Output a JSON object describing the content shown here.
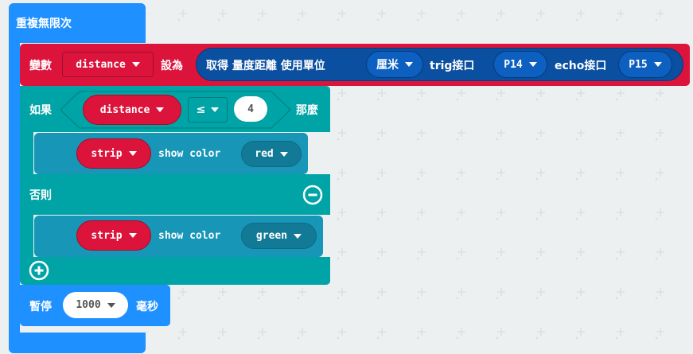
{
  "forever": {
    "label": "重複無限次",
    "color": "#1e90ff"
  },
  "set_var": {
    "label": "變數",
    "var_name": "distance",
    "assign_label": "設為",
    "color": "#dc143c",
    "sonar": {
      "label_get": "取得 量度距離 使用單位",
      "unit": "厘米",
      "trig_label": "trig接口",
      "trig_pin": "P14",
      "echo_label": "echo接口",
      "echo_pin": "P15",
      "color": "#0a4fa0"
    }
  },
  "if_block": {
    "if_label": "如果",
    "then_label": "那麼",
    "else_label": "否則",
    "condition": {
      "left": "distance",
      "operator": "≤",
      "right": "4"
    },
    "color": "#00a4a6",
    "then_action": {
      "var": "strip",
      "label": "show color",
      "color_value": "red"
    },
    "else_action": {
      "var": "strip",
      "label": "show color",
      "color_value": "green"
    }
  },
  "pause": {
    "label": "暫停",
    "value": "1000",
    "unit": "毫秒"
  }
}
